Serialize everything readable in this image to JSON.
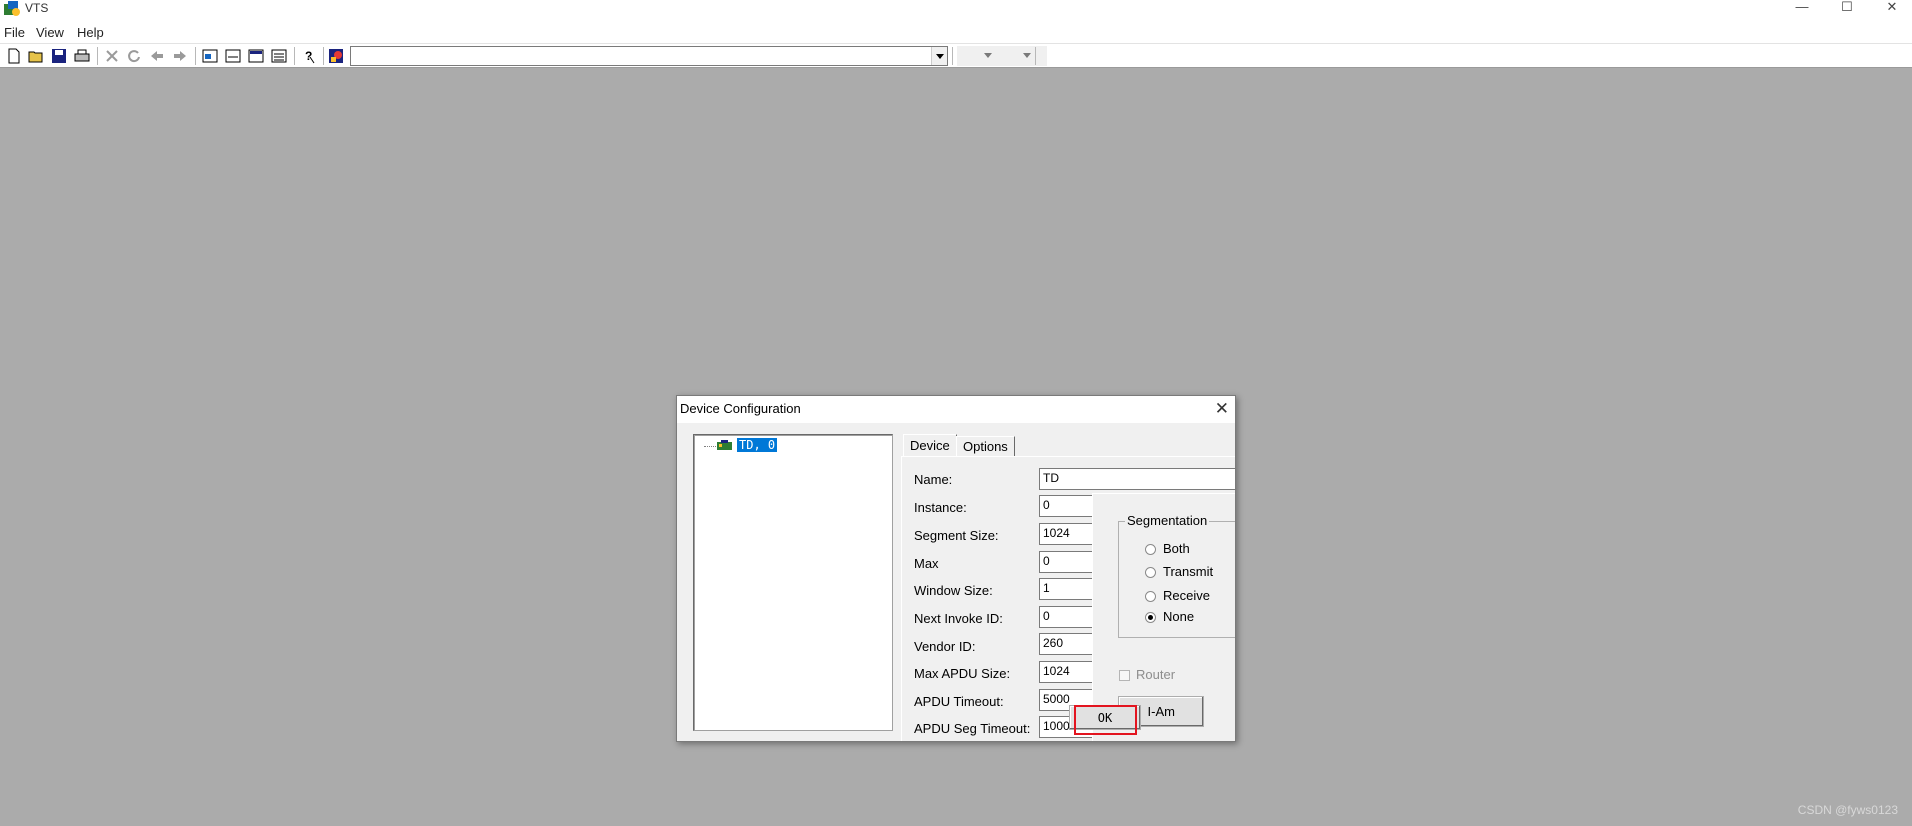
{
  "window": {
    "title": "VTS",
    "controls": [
      "—",
      "☐",
      "✕"
    ]
  },
  "menu": [
    "File",
    "View",
    "Help"
  ],
  "dialog": {
    "title": "Device Configuration",
    "close_glyph": "✕",
    "tree": {
      "selected_node": "TD, 0"
    },
    "tabs": {
      "device": "Device",
      "options": "Options"
    },
    "fields": [
      {
        "label": "Name:",
        "value": "TD"
      },
      {
        "label": "Instance:",
        "value": "0"
      },
      {
        "label": "Segment Size:",
        "value": "1024"
      },
      {
        "label": "Max",
        "value": "0"
      },
      {
        "label": "Window Size:",
        "value": "1"
      },
      {
        "label": "Next Invoke ID:",
        "value": "0"
      },
      {
        "label": "Vendor ID:",
        "value": "260"
      },
      {
        "label": "Max APDU Size:",
        "value": "1024"
      },
      {
        "label": "APDU Timeout:",
        "value": "5000"
      },
      {
        "label": "APDU Seg Timeout:",
        "value": "1000"
      }
    ],
    "segmentation": {
      "title": "Segmentation",
      "options": [
        "Both",
        "Transmit",
        "Receive",
        "None"
      ],
      "selected": "None"
    },
    "router": {
      "label": "Router",
      "checked": false,
      "enabled": false
    },
    "iam_button": "I-Am",
    "ok_button": "OK"
  },
  "watermark": "CSDN @fyws0123",
  "colors": {
    "desktop": "#ababab",
    "selection": "#0078d7",
    "highlight_box": "#e3141f"
  }
}
